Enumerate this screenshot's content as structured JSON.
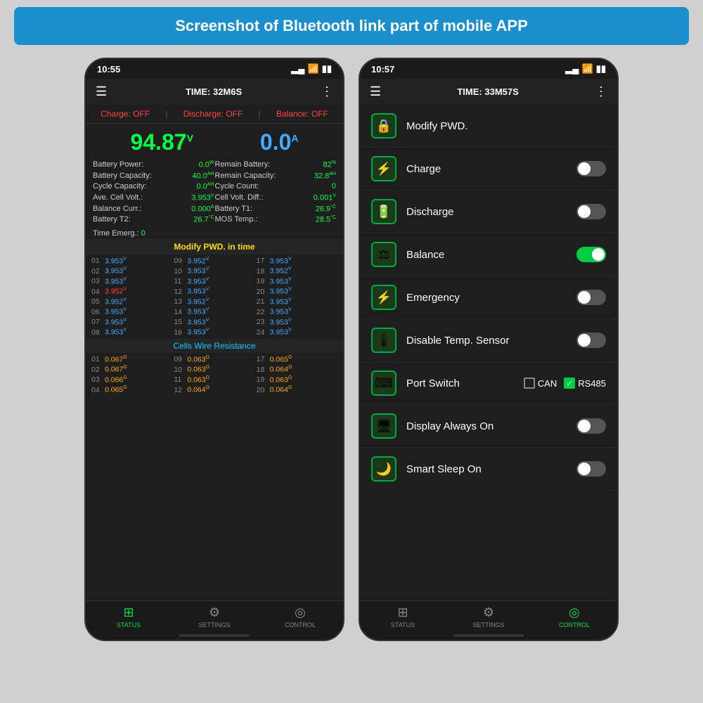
{
  "page": {
    "title": "Screenshot of Bluetooth link part of mobile APP",
    "background": "#d0d0d0"
  },
  "left_phone": {
    "status_bar": {
      "time": "10:55",
      "signal": "▂▄",
      "wifi": "wifi",
      "battery": "battery"
    },
    "app_bar": {
      "time_label": "TIME: 32M6S"
    },
    "status_row": {
      "charge": "Charge:",
      "charge_val": "OFF",
      "discharge": "Discharge:",
      "discharge_val": "OFF",
      "balance": "Balance:",
      "balance_val": "OFF"
    },
    "big_volt": "94.87",
    "volt_unit": "V",
    "big_amp": "0.0",
    "amp_unit": "A",
    "info": {
      "battery_power_label": "Battery Power:",
      "battery_power_val": "0.0",
      "battery_power_unit": "W",
      "remain_battery_label": "Remain Battery:",
      "remain_battery_val": "82",
      "remain_battery_unit": "%",
      "battery_capacity_label": "Battery Capacity:",
      "battery_capacity_val": "40.0",
      "battery_capacity_unit": "AH",
      "remain_capacity_label": "Remain Capacity:",
      "remain_capacity_val": "32.8",
      "remain_capacity_unit": "AH",
      "cycle_capacity_label": "Cycle Capacity:",
      "cycle_capacity_val": "0.0",
      "cycle_capacity_unit": "AH",
      "cycle_count_label": "Cycle Count:",
      "cycle_count_val": "0",
      "ave_cell_volt_label": "Ave. Cell Volt.:",
      "ave_cell_volt_val": "3.953",
      "ave_cell_volt_unit": "V",
      "cell_volt_diff_label": "Cell Volt. Diff.:",
      "cell_volt_diff_val": "0.001",
      "cell_volt_diff_unit": "V",
      "balance_curr_label": "Balance Curr.:",
      "balance_curr_val": "0.000",
      "balance_curr_unit": "A",
      "battery_t1_label": "Battery T1:",
      "battery_t1_val": "26.9",
      "battery_t1_unit": "°C",
      "battery_t2_label": "Battery T2:",
      "battery_t2_val": "26.7",
      "battery_t2_unit": "°C",
      "mos_temp_label": "MOS Temp.:",
      "mos_temp_val": "28.5",
      "mos_temp_unit": "°C",
      "time_emerg_label": "Time Emerg.:",
      "time_emerg_val": "0"
    },
    "modify_time": "Modify PWD. in time",
    "cells": [
      {
        "num": "01",
        "val": "3.953",
        "color": "blue"
      },
      {
        "num": "09",
        "val": "3.952",
        "color": "blue"
      },
      {
        "num": "17",
        "val": "3.953",
        "color": "blue"
      },
      {
        "num": "02",
        "val": "3.953",
        "color": "blue"
      },
      {
        "num": "10",
        "val": "3.953",
        "color": "blue"
      },
      {
        "num": "18",
        "val": "3.952",
        "color": "blue"
      },
      {
        "num": "03",
        "val": "3.953",
        "color": "blue"
      },
      {
        "num": "11",
        "val": "3.953",
        "color": "blue"
      },
      {
        "num": "19",
        "val": "3.953",
        "color": "blue"
      },
      {
        "num": "04",
        "val": "3.952",
        "color": "red"
      },
      {
        "num": "12",
        "val": "3.953",
        "color": "blue"
      },
      {
        "num": "20",
        "val": "3.953",
        "color": "blue"
      },
      {
        "num": "05",
        "val": "3.952",
        "color": "blue"
      },
      {
        "num": "13",
        "val": "3.952",
        "color": "blue"
      },
      {
        "num": "21",
        "val": "3.953",
        "color": "blue"
      },
      {
        "num": "06",
        "val": "3.953",
        "color": "blue"
      },
      {
        "num": "14",
        "val": "3.953",
        "color": "blue"
      },
      {
        "num": "22",
        "val": "3.953",
        "color": "blue"
      },
      {
        "num": "07",
        "val": "3.953",
        "color": "blue"
      },
      {
        "num": "15",
        "val": "3.953",
        "color": "blue"
      },
      {
        "num": "23",
        "val": "3.953",
        "color": "blue"
      },
      {
        "num": "08",
        "val": "3.953",
        "color": "blue"
      },
      {
        "num": "16",
        "val": "3.953",
        "color": "blue"
      },
      {
        "num": "24",
        "val": "3.953",
        "color": "blue"
      }
    ],
    "resistance_header": "Cells Wire Resistance",
    "resistances": [
      {
        "num": "01",
        "val": "0.067"
      },
      {
        "num": "09",
        "val": "0.063"
      },
      {
        "num": "17",
        "val": "0.065"
      },
      {
        "num": "02",
        "val": "0.067"
      },
      {
        "num": "10",
        "val": "0.063"
      },
      {
        "num": "18",
        "val": "0.064"
      },
      {
        "num": "03",
        "val": "0.066"
      },
      {
        "num": "11",
        "val": "0.063"
      },
      {
        "num": "19",
        "val": "0.063"
      },
      {
        "num": "04",
        "val": "0.065"
      },
      {
        "num": "12",
        "val": "0.064"
      },
      {
        "num": "20",
        "val": "0.064"
      }
    ],
    "nav": {
      "status": "STATUS",
      "settings": "SETTINGS",
      "control": "CONTROL"
    }
  },
  "right_phone": {
    "status_bar": {
      "time": "10:57"
    },
    "app_bar": {
      "time_label": "TIME: 33M57S"
    },
    "controls": [
      {
        "id": "modify-pwd",
        "icon": "🔒",
        "label": "Modify PWD.",
        "type": "none"
      },
      {
        "id": "charge",
        "icon": "⚡",
        "label": "Charge",
        "type": "toggle",
        "state": "off"
      },
      {
        "id": "discharge",
        "icon": "🔋",
        "label": "Discharge",
        "type": "toggle",
        "state": "off"
      },
      {
        "id": "balance",
        "icon": "⚖",
        "label": "Balance",
        "type": "toggle",
        "state": "on"
      },
      {
        "id": "emergency",
        "icon": "⚡",
        "label": "Emergency",
        "type": "toggle",
        "state": "off"
      },
      {
        "id": "disable-temp",
        "icon": "🌡",
        "label": "Disable Temp. Sensor",
        "type": "toggle",
        "state": "off"
      },
      {
        "id": "port-switch",
        "icon": "⌨",
        "label": "Port Switch",
        "type": "checkboxes",
        "options": [
          {
            "label": "CAN",
            "checked": false
          },
          {
            "label": "RS485",
            "checked": true
          }
        ]
      },
      {
        "id": "display-always-on",
        "icon": "🖥",
        "label": "Display Always On",
        "type": "toggle",
        "state": "off"
      },
      {
        "id": "smart-sleep",
        "icon": "🌙",
        "label": "Smart Sleep On",
        "type": "toggle",
        "state": "off"
      }
    ],
    "nav": {
      "status": "STATUS",
      "settings": "SETTINGS",
      "control": "CONTROL"
    }
  }
}
